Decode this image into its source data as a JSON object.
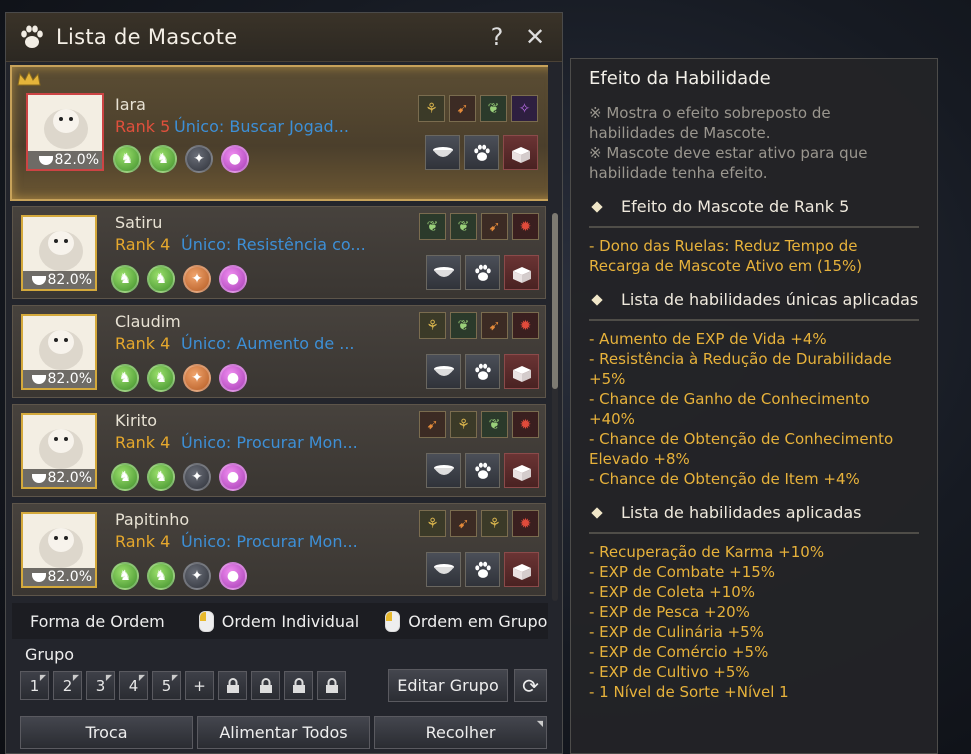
{
  "window": {
    "title": "Lista de Mascote",
    "help_label": "?",
    "close_label": "✕"
  },
  "pets": [
    {
      "name": "Iara",
      "rank": "Rank 5",
      "unique": "Único: Buscar Jogad...",
      "feed": "82.0%",
      "selected": true,
      "circles": [
        "green",
        "green",
        "gray",
        "purple"
      ],
      "skills": [
        "s1",
        "s3",
        "s2",
        "s5"
      ]
    },
    {
      "name": "Satiru",
      "rank": "Rank 4",
      "unique": "Único: Resistência co...",
      "feed": "82.0%",
      "circles": [
        "green",
        "green",
        "orange",
        "purple"
      ],
      "skills": [
        "s2",
        "s2",
        "s3",
        "s4"
      ]
    },
    {
      "name": "Claudim",
      "rank": "Rank 4",
      "unique": "Único: Aumento de ...",
      "feed": "82.0%",
      "circles": [
        "green",
        "green",
        "orange",
        "purple"
      ],
      "skills": [
        "s1",
        "s2",
        "s3",
        "s4"
      ]
    },
    {
      "name": "Kirito",
      "rank": "Rank 4",
      "unique": "Único: Procurar Mon...",
      "feed": "82.0%",
      "circles": [
        "green",
        "green",
        "gray",
        "purple"
      ],
      "skills": [
        "s3",
        "s1",
        "s2",
        "s4"
      ]
    },
    {
      "name": "Papitinho",
      "rank": "Rank 4",
      "unique": "Único: Procurar Mon...",
      "feed": "82.0%",
      "circles": [
        "green",
        "green",
        "gray",
        "purple"
      ],
      "skills": [
        "s1",
        "s3",
        "s1",
        "s4"
      ]
    }
  ],
  "sort": {
    "label": "Forma de Ordem",
    "individual": "Ordem Individual",
    "group": "Ordem em Grupo"
  },
  "group": {
    "label": "Grupo",
    "buttons": [
      "1",
      "2",
      "3",
      "4",
      "5"
    ],
    "add": "+",
    "edit": "Editar Grupo"
  },
  "bottom": {
    "swap": "Troca",
    "feed_all": "Alimentar Todos",
    "collect": "Recolher"
  },
  "effect": {
    "title": "Efeito da Habilidade",
    "note1": "※ Mostra o efeito sobreposto de habilidades de Mascote.",
    "note2": "※ Mascote deve estar ativo para que habilidade tenha efeito.",
    "rank_head": "Efeito do Mascote de Rank 5",
    "rank_lines": [
      "- Dono das Ruelas: Reduz Tempo de Recarga de Mascote Ativo em (15%)"
    ],
    "unique_head": "Lista de habilidades únicas aplicadas",
    "unique_lines": [
      "- Aumento de EXP de Vida +4%",
      "- Resistência à Redução de Durabilidade +5%",
      "- Chance de Ganho de Conhecimento +40%",
      "- Chance de Obtenção de Conhecimento Elevado +8%",
      "- Chance de Obtenção de Item +4%"
    ],
    "applied_head": "Lista de habilidades aplicadas",
    "applied_lines": [
      "- Recuperação de Karma +10%",
      "- EXP de Combate +15%",
      "- EXP de Coleta +10%",
      "- EXP de Pesca +20%",
      "- EXP de Culinária +5%",
      "- EXP de Comércio +5%",
      "- EXP de Cultivo +5%",
      "- 1 Nível de Sorte +Nível 1"
    ]
  }
}
